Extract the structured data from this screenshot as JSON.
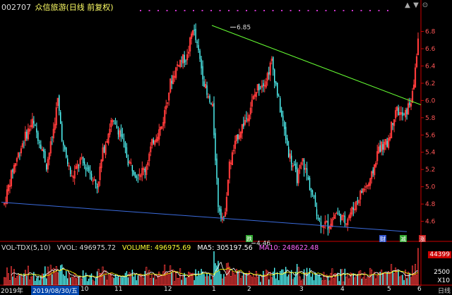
{
  "header": {
    "code": "002707",
    "name": "众信旅游(日线 前复权)"
  },
  "volume_header": {
    "indicator": "VOL-TDX(5,10)",
    "vvol": "VVOL: 496975.72",
    "volume": "VOLUME: 496975.69",
    "ma5": "MA5: 305197.56",
    "ma10": "MA10: 248622.48"
  },
  "colors": {
    "up": "#ff3b3b",
    "down": "#54ffff",
    "ma5": "#ffffff",
    "ma10": "#ffff00",
    "trend_upper": "#66ff33",
    "trend_lower": "#3b6bdc",
    "axis_red": "#cc0000",
    "event_dots": "#cc33cc"
  },
  "icons": {
    "dots": "event-dots-icon",
    "up_arrow": "scroll-up-icon",
    "down_arrow": "scroll-down-icon"
  },
  "time_axis": {
    "labels": [
      "2019年",
      "2019/08/30/五",
      "10",
      "11",
      "12",
      "1",
      "2",
      "3",
      "4",
      "5",
      "6"
    ],
    "selected": "2019/08/30/五",
    "period": "日线"
  },
  "markers": {
    "high": "6.85",
    "low": "4.46",
    "tags": [
      "跌",
      "财",
      "减",
      "涨"
    ]
  },
  "right_tags": {
    "volume_top": "44399",
    "volume_mid": "2500",
    "volume_unit": "X10"
  },
  "chart_data": {
    "type": "candlestick",
    "title": "",
    "price_axis": {
      "ticks": [
        "6.8",
        "6.6",
        "6.4",
        "6.2",
        "6.0",
        "5.8",
        "5.6",
        "5.4",
        "5.2",
        "5.0",
        "4.8",
        "4.6"
      ],
      "ylim": [
        4.5,
        6.9
      ]
    },
    "volume_axis": {
      "ticks": [
        "44399",
        "2500",
        "X10"
      ]
    },
    "trendlines": [
      {
        "name": "upper",
        "from_price": 6.87,
        "to_price": 5.95
      },
      {
        "name": "lower",
        "from_price": 4.82,
        "to_price": 4.48
      }
    ],
    "high_point": 6.85,
    "low_point": 4.46,
    "last_close": 6.7,
    "series_summary": "Daily OHLC ~2019/08 through 2020/06"
  }
}
